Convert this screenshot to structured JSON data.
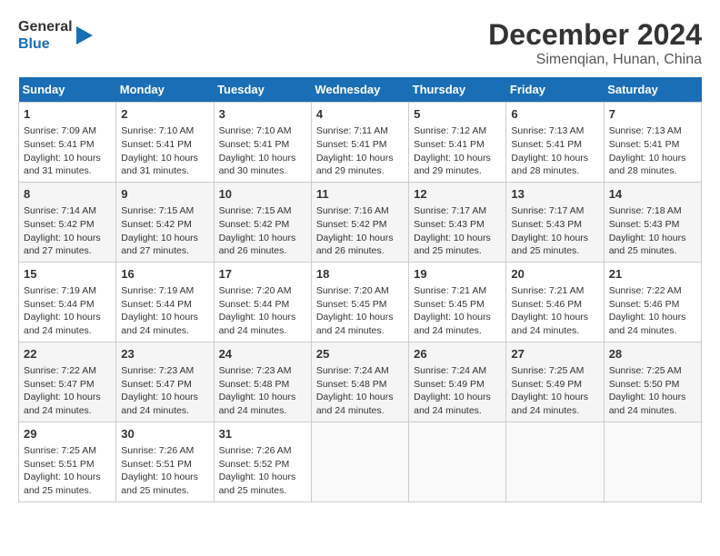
{
  "logo": {
    "line1": "General",
    "line2": "Blue"
  },
  "title": "December 2024",
  "subtitle": "Simenqian, Hunan, China",
  "days_of_week": [
    "Sunday",
    "Monday",
    "Tuesday",
    "Wednesday",
    "Thursday",
    "Friday",
    "Saturday"
  ],
  "weeks": [
    [
      {
        "day": "1",
        "sunrise": "Sunrise: 7:09 AM",
        "sunset": "Sunset: 5:41 PM",
        "daylight": "Daylight: 10 hours and 31 minutes."
      },
      {
        "day": "2",
        "sunrise": "Sunrise: 7:10 AM",
        "sunset": "Sunset: 5:41 PM",
        "daylight": "Daylight: 10 hours and 31 minutes."
      },
      {
        "day": "3",
        "sunrise": "Sunrise: 7:10 AM",
        "sunset": "Sunset: 5:41 PM",
        "daylight": "Daylight: 10 hours and 30 minutes."
      },
      {
        "day": "4",
        "sunrise": "Sunrise: 7:11 AM",
        "sunset": "Sunset: 5:41 PM",
        "daylight": "Daylight: 10 hours and 29 minutes."
      },
      {
        "day": "5",
        "sunrise": "Sunrise: 7:12 AM",
        "sunset": "Sunset: 5:41 PM",
        "daylight": "Daylight: 10 hours and 29 minutes."
      },
      {
        "day": "6",
        "sunrise": "Sunrise: 7:13 AM",
        "sunset": "Sunset: 5:41 PM",
        "daylight": "Daylight: 10 hours and 28 minutes."
      },
      {
        "day": "7",
        "sunrise": "Sunrise: 7:13 AM",
        "sunset": "Sunset: 5:41 PM",
        "daylight": "Daylight: 10 hours and 28 minutes."
      }
    ],
    [
      {
        "day": "8",
        "sunrise": "Sunrise: 7:14 AM",
        "sunset": "Sunset: 5:42 PM",
        "daylight": "Daylight: 10 hours and 27 minutes."
      },
      {
        "day": "9",
        "sunrise": "Sunrise: 7:15 AM",
        "sunset": "Sunset: 5:42 PM",
        "daylight": "Daylight: 10 hours and 27 minutes."
      },
      {
        "day": "10",
        "sunrise": "Sunrise: 7:15 AM",
        "sunset": "Sunset: 5:42 PM",
        "daylight": "Daylight: 10 hours and 26 minutes."
      },
      {
        "day": "11",
        "sunrise": "Sunrise: 7:16 AM",
        "sunset": "Sunset: 5:42 PM",
        "daylight": "Daylight: 10 hours and 26 minutes."
      },
      {
        "day": "12",
        "sunrise": "Sunrise: 7:17 AM",
        "sunset": "Sunset: 5:43 PM",
        "daylight": "Daylight: 10 hours and 25 minutes."
      },
      {
        "day": "13",
        "sunrise": "Sunrise: 7:17 AM",
        "sunset": "Sunset: 5:43 PM",
        "daylight": "Daylight: 10 hours and 25 minutes."
      },
      {
        "day": "14",
        "sunrise": "Sunrise: 7:18 AM",
        "sunset": "Sunset: 5:43 PM",
        "daylight": "Daylight: 10 hours and 25 minutes."
      }
    ],
    [
      {
        "day": "15",
        "sunrise": "Sunrise: 7:19 AM",
        "sunset": "Sunset: 5:44 PM",
        "daylight": "Daylight: 10 hours and 24 minutes."
      },
      {
        "day": "16",
        "sunrise": "Sunrise: 7:19 AM",
        "sunset": "Sunset: 5:44 PM",
        "daylight": "Daylight: 10 hours and 24 minutes."
      },
      {
        "day": "17",
        "sunrise": "Sunrise: 7:20 AM",
        "sunset": "Sunset: 5:44 PM",
        "daylight": "Daylight: 10 hours and 24 minutes."
      },
      {
        "day": "18",
        "sunrise": "Sunrise: 7:20 AM",
        "sunset": "Sunset: 5:45 PM",
        "daylight": "Daylight: 10 hours and 24 minutes."
      },
      {
        "day": "19",
        "sunrise": "Sunrise: 7:21 AM",
        "sunset": "Sunset: 5:45 PM",
        "daylight": "Daylight: 10 hours and 24 minutes."
      },
      {
        "day": "20",
        "sunrise": "Sunrise: 7:21 AM",
        "sunset": "Sunset: 5:46 PM",
        "daylight": "Daylight: 10 hours and 24 minutes."
      },
      {
        "day": "21",
        "sunrise": "Sunrise: 7:22 AM",
        "sunset": "Sunset: 5:46 PM",
        "daylight": "Daylight: 10 hours and 24 minutes."
      }
    ],
    [
      {
        "day": "22",
        "sunrise": "Sunrise: 7:22 AM",
        "sunset": "Sunset: 5:47 PM",
        "daylight": "Daylight: 10 hours and 24 minutes."
      },
      {
        "day": "23",
        "sunrise": "Sunrise: 7:23 AM",
        "sunset": "Sunset: 5:47 PM",
        "daylight": "Daylight: 10 hours and 24 minutes."
      },
      {
        "day": "24",
        "sunrise": "Sunrise: 7:23 AM",
        "sunset": "Sunset: 5:48 PM",
        "daylight": "Daylight: 10 hours and 24 minutes."
      },
      {
        "day": "25",
        "sunrise": "Sunrise: 7:24 AM",
        "sunset": "Sunset: 5:48 PM",
        "daylight": "Daylight: 10 hours and 24 minutes."
      },
      {
        "day": "26",
        "sunrise": "Sunrise: 7:24 AM",
        "sunset": "Sunset: 5:49 PM",
        "daylight": "Daylight: 10 hours and 24 minutes."
      },
      {
        "day": "27",
        "sunrise": "Sunrise: 7:25 AM",
        "sunset": "Sunset: 5:49 PM",
        "daylight": "Daylight: 10 hours and 24 minutes."
      },
      {
        "day": "28",
        "sunrise": "Sunrise: 7:25 AM",
        "sunset": "Sunset: 5:50 PM",
        "daylight": "Daylight: 10 hours and 24 minutes."
      }
    ],
    [
      {
        "day": "29",
        "sunrise": "Sunrise: 7:25 AM",
        "sunset": "Sunset: 5:51 PM",
        "daylight": "Daylight: 10 hours and 25 minutes."
      },
      {
        "day": "30",
        "sunrise": "Sunrise: 7:26 AM",
        "sunset": "Sunset: 5:51 PM",
        "daylight": "Daylight: 10 hours and 25 minutes."
      },
      {
        "day": "31",
        "sunrise": "Sunrise: 7:26 AM",
        "sunset": "Sunset: 5:52 PM",
        "daylight": "Daylight: 10 hours and 25 minutes."
      },
      null,
      null,
      null,
      null
    ]
  ]
}
